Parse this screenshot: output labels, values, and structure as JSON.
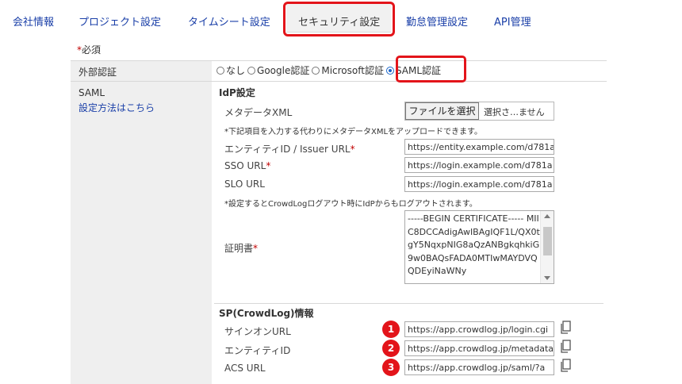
{
  "tabs": [
    {
      "label": "会社情報"
    },
    {
      "label": "プロジェクト設定"
    },
    {
      "label": "タイムシート設定"
    },
    {
      "label": "セキュリティ設定"
    },
    {
      "label": "勤怠管理設定"
    },
    {
      "label": "API管理"
    }
  ],
  "active_tab": "セキュリティ設定",
  "form": {
    "required_star": "*",
    "required_note": "必須",
    "external_auth": {
      "label": "外部認証",
      "options": [
        "なし",
        "Google認証",
        "Microsoft認証",
        "SAML認証"
      ],
      "selected": "SAML認証"
    },
    "saml": {
      "label": "SAML",
      "howto_link": "設定方法はこちら"
    },
    "idp": {
      "heading": "IdP設定",
      "metadata_label": "メタデータXML",
      "file_button": "ファイルを選択",
      "file_status": "選択さ…ません",
      "upload_note": "*下記項目を入力する代わりにメタデータXMLをアップロードできます。",
      "entity_label": "エンティティID / Issuer URL",
      "entity_value": "https://entity.example.com/d781a",
      "sso_label": "SSO URL",
      "sso_value": "https://login.example.com/d781a",
      "slo_label": "SLO URL",
      "slo_value": "https://login.example.com/d781a",
      "logout_note": "*設定するとCrowdLogログアウト時にIdPからもログアウトされます。",
      "cert_label": "証明書",
      "cert_value": "-----BEGIN CERTIFICATE-----\nMIIC8DCCAdigAwIBAgIQF1L/QX0tgY5NqxpNIG8aQzANBgkqhkiG9w0BAQsFADA0MTIwMAYDVQQDEyiNaWNy"
    },
    "sp": {
      "heading": "SP(CrowdLog)情報",
      "signon_label": "サインオンURL",
      "signon_value": "https://app.crowdlog.jp/login.cgi",
      "entity_label": "エンティティID",
      "entity_value": "https://app.crowdlog.jp/metadata",
      "acs_label": "ACS URL",
      "acs_value": "https://app.crowdlog.jp/saml/?a",
      "badges": [
        "1",
        "2",
        "3"
      ]
    }
  },
  "colors": {
    "highlight": "#e3141a",
    "link": "#1a3fa8",
    "label_column": "#efefef",
    "required": "#c00000"
  }
}
